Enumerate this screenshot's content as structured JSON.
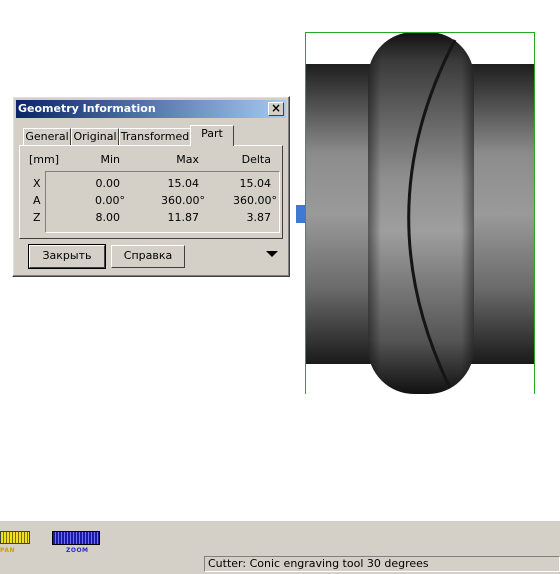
{
  "dialog": {
    "title": "Geometry Information",
    "close_symbol": "×",
    "tabs": [
      {
        "label": "General"
      },
      {
        "label": "Original"
      },
      {
        "label": "Transformed"
      },
      {
        "label": "Part",
        "active": true
      }
    ],
    "table": {
      "unit": "[mm]",
      "headers": [
        "Min",
        "Max",
        "Delta"
      ],
      "rows": [
        {
          "axis": "X",
          "min": "0.00",
          "max": "15.04",
          "delta": "15.04"
        },
        {
          "axis": "A",
          "min": "0.00°",
          "max": "360.00°",
          "delta": "360.00°"
        },
        {
          "axis": "Z",
          "min": "8.00",
          "max": "11.87",
          "delta": "3.87"
        }
      ]
    },
    "buttons": {
      "close": "Закрыть",
      "help": "Справка"
    }
  },
  "toolbar": {
    "pan_label": "PAN",
    "zoom_label": "ZOOM",
    "colors": {
      "pan": "#f0e020",
      "zoom": "#2a2ad0"
    }
  },
  "status": {
    "cutter": "Cutter: Conic engraving tool 30 degrees"
  },
  "viewport": {
    "frame_color": "#22aa22",
    "marker_color": "#3d7ad6"
  }
}
